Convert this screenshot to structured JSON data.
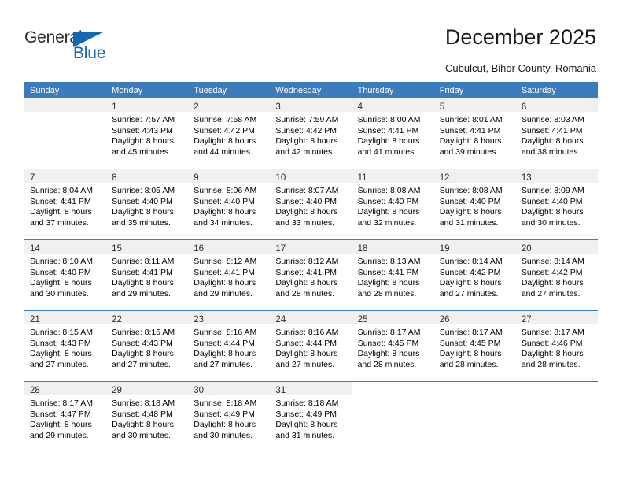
{
  "brand": {
    "name_part1": "General",
    "name_part2": "Blue",
    "accent_color": "#1168b3",
    "triangle_icon": "triangle-right-icon"
  },
  "header": {
    "title": "December 2025",
    "subtitle": "Cubulcut, Bihor County, Romania"
  },
  "calendar": {
    "header_bg": "#3a7cbe",
    "daynum_bg": "#f0f0f0",
    "weekday_headers": [
      "Sunday",
      "Monday",
      "Tuesday",
      "Wednesday",
      "Thursday",
      "Friday",
      "Saturday"
    ],
    "weeks": [
      [
        {
          "day": "",
          "lines": []
        },
        {
          "day": "1",
          "lines": [
            "Sunrise: 7:57 AM",
            "Sunset: 4:43 PM",
            "Daylight: 8 hours",
            "and 45 minutes."
          ]
        },
        {
          "day": "2",
          "lines": [
            "Sunrise: 7:58 AM",
            "Sunset: 4:42 PM",
            "Daylight: 8 hours",
            "and 44 minutes."
          ]
        },
        {
          "day": "3",
          "lines": [
            "Sunrise: 7:59 AM",
            "Sunset: 4:42 PM",
            "Daylight: 8 hours",
            "and 42 minutes."
          ]
        },
        {
          "day": "4",
          "lines": [
            "Sunrise: 8:00 AM",
            "Sunset: 4:41 PM",
            "Daylight: 8 hours",
            "and 41 minutes."
          ]
        },
        {
          "day": "5",
          "lines": [
            "Sunrise: 8:01 AM",
            "Sunset: 4:41 PM",
            "Daylight: 8 hours",
            "and 39 minutes."
          ]
        },
        {
          "day": "6",
          "lines": [
            "Sunrise: 8:03 AM",
            "Sunset: 4:41 PM",
            "Daylight: 8 hours",
            "and 38 minutes."
          ]
        }
      ],
      [
        {
          "day": "7",
          "lines": [
            "Sunrise: 8:04 AM",
            "Sunset: 4:41 PM",
            "Daylight: 8 hours",
            "and 37 minutes."
          ]
        },
        {
          "day": "8",
          "lines": [
            "Sunrise: 8:05 AM",
            "Sunset: 4:40 PM",
            "Daylight: 8 hours",
            "and 35 minutes."
          ]
        },
        {
          "day": "9",
          "lines": [
            "Sunrise: 8:06 AM",
            "Sunset: 4:40 PM",
            "Daylight: 8 hours",
            "and 34 minutes."
          ]
        },
        {
          "day": "10",
          "lines": [
            "Sunrise: 8:07 AM",
            "Sunset: 4:40 PM",
            "Daylight: 8 hours",
            "and 33 minutes."
          ]
        },
        {
          "day": "11",
          "lines": [
            "Sunrise: 8:08 AM",
            "Sunset: 4:40 PM",
            "Daylight: 8 hours",
            "and 32 minutes."
          ]
        },
        {
          "day": "12",
          "lines": [
            "Sunrise: 8:08 AM",
            "Sunset: 4:40 PM",
            "Daylight: 8 hours",
            "and 31 minutes."
          ]
        },
        {
          "day": "13",
          "lines": [
            "Sunrise: 8:09 AM",
            "Sunset: 4:40 PM",
            "Daylight: 8 hours",
            "and 30 minutes."
          ]
        }
      ],
      [
        {
          "day": "14",
          "lines": [
            "Sunrise: 8:10 AM",
            "Sunset: 4:40 PM",
            "Daylight: 8 hours",
            "and 30 minutes."
          ]
        },
        {
          "day": "15",
          "lines": [
            "Sunrise: 8:11 AM",
            "Sunset: 4:41 PM",
            "Daylight: 8 hours",
            "and 29 minutes."
          ]
        },
        {
          "day": "16",
          "lines": [
            "Sunrise: 8:12 AM",
            "Sunset: 4:41 PM",
            "Daylight: 8 hours",
            "and 29 minutes."
          ]
        },
        {
          "day": "17",
          "lines": [
            "Sunrise: 8:12 AM",
            "Sunset: 4:41 PM",
            "Daylight: 8 hours",
            "and 28 minutes."
          ]
        },
        {
          "day": "18",
          "lines": [
            "Sunrise: 8:13 AM",
            "Sunset: 4:41 PM",
            "Daylight: 8 hours",
            "and 28 minutes."
          ]
        },
        {
          "day": "19",
          "lines": [
            "Sunrise: 8:14 AM",
            "Sunset: 4:42 PM",
            "Daylight: 8 hours",
            "and 27 minutes."
          ]
        },
        {
          "day": "20",
          "lines": [
            "Sunrise: 8:14 AM",
            "Sunset: 4:42 PM",
            "Daylight: 8 hours",
            "and 27 minutes."
          ]
        }
      ],
      [
        {
          "day": "21",
          "lines": [
            "Sunrise: 8:15 AM",
            "Sunset: 4:43 PM",
            "Daylight: 8 hours",
            "and 27 minutes."
          ]
        },
        {
          "day": "22",
          "lines": [
            "Sunrise: 8:15 AM",
            "Sunset: 4:43 PM",
            "Daylight: 8 hours",
            "and 27 minutes."
          ]
        },
        {
          "day": "23",
          "lines": [
            "Sunrise: 8:16 AM",
            "Sunset: 4:44 PM",
            "Daylight: 8 hours",
            "and 27 minutes."
          ]
        },
        {
          "day": "24",
          "lines": [
            "Sunrise: 8:16 AM",
            "Sunset: 4:44 PM",
            "Daylight: 8 hours",
            "and 27 minutes."
          ]
        },
        {
          "day": "25",
          "lines": [
            "Sunrise: 8:17 AM",
            "Sunset: 4:45 PM",
            "Daylight: 8 hours",
            "and 28 minutes."
          ]
        },
        {
          "day": "26",
          "lines": [
            "Sunrise: 8:17 AM",
            "Sunset: 4:45 PM",
            "Daylight: 8 hours",
            "and 28 minutes."
          ]
        },
        {
          "day": "27",
          "lines": [
            "Sunrise: 8:17 AM",
            "Sunset: 4:46 PM",
            "Daylight: 8 hours",
            "and 28 minutes."
          ]
        }
      ],
      [
        {
          "day": "28",
          "lines": [
            "Sunrise: 8:17 AM",
            "Sunset: 4:47 PM",
            "Daylight: 8 hours",
            "and 29 minutes."
          ]
        },
        {
          "day": "29",
          "lines": [
            "Sunrise: 8:18 AM",
            "Sunset: 4:48 PM",
            "Daylight: 8 hours",
            "and 30 minutes."
          ]
        },
        {
          "day": "30",
          "lines": [
            "Sunrise: 8:18 AM",
            "Sunset: 4:49 PM",
            "Daylight: 8 hours",
            "and 30 minutes."
          ]
        },
        {
          "day": "31",
          "lines": [
            "Sunrise: 8:18 AM",
            "Sunset: 4:49 PM",
            "Daylight: 8 hours",
            "and 31 minutes."
          ]
        },
        {
          "day": "",
          "lines": []
        },
        {
          "day": "",
          "lines": []
        },
        {
          "day": "",
          "lines": []
        }
      ]
    ]
  }
}
